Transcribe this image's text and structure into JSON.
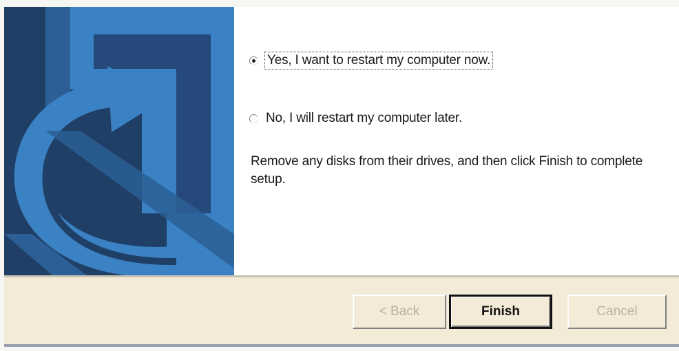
{
  "options": {
    "restart_now_label": "Yes, I want to restart my computer now.",
    "restart_later_label": "No, I will restart my computer later.",
    "selected": "restart_now"
  },
  "instructions": "Remove any disks from their drives, and then click Finish to complete setup.",
  "buttons": {
    "back_label": "< Back",
    "finish_label": "Finish",
    "cancel_label": "Cancel"
  },
  "colors": {
    "art_dark_blue": "#1f3f66",
    "art_light_blue": "#3d86c8",
    "button_bar": "#f3ead7"
  }
}
